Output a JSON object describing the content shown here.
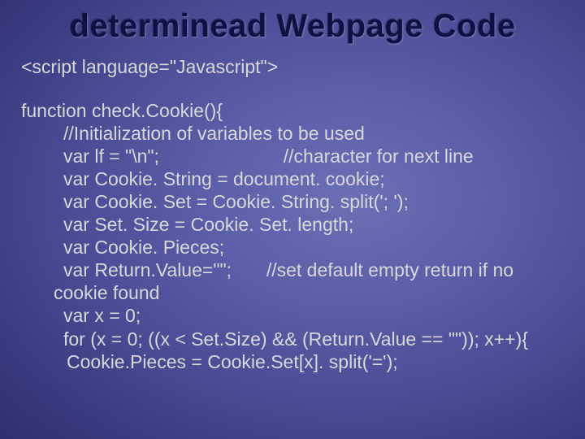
{
  "title": "determinead Webpage Code",
  "code": {
    "l1": "<script language=\"Javascript\">",
    "l2": "function check.Cookie(){",
    "l3": "//Initialization of variables to be used",
    "l4a": "var lf = \"\\n\";",
    "l4b": "//character for next line",
    "l5": "var Cookie. String = document. cookie;",
    "l6": "var Cookie. Set = Cookie. String. split('; ');",
    "l7": "var Set. Size = Cookie. Set. length;",
    "l8": "var Cookie. Pieces;",
    "l9a": "var Return.Value=\"\";",
    "l9b": "//set default empty return if no",
    "l10": "cookie found",
    "l11": "var x = 0;",
    "l12": "for (x = 0; ((x < Set.Size) && (Return.Value == \"\")); x++){",
    "l13": "Cookie.Pieces = Cookie.Set[x]. split('=');"
  }
}
